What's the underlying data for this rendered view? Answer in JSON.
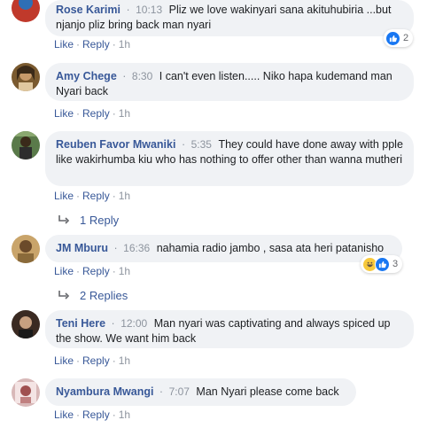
{
  "actions": {
    "like": "Like",
    "reply": "Reply",
    "dot": "·"
  },
  "comments": [
    {
      "author": "Rose Karimi",
      "time": "10:13",
      "text": "Pliz we love wakinyari sana akituhubiria ...but njanjo pliz bring back man nyari",
      "age": "1h",
      "reactions": {
        "icons": [
          "like-icon"
        ],
        "count": "2"
      },
      "avatar_colors": [
        "#c0392b",
        "#2e6fb5"
      ]
    },
    {
      "author": "Amy Chege",
      "time": "8:30",
      "text": "I can't even listen..... Niko hapa kudemand man Nyari back",
      "age": "1h",
      "avatar_colors": [
        "#7a5a2f",
        "#3b2a18"
      ]
    },
    {
      "author": "Reuben Favor Mwaniki",
      "time": "5:35",
      "text": "They could have done away with pple like wakirhumba kiu who has nothing to offer other than wanna mutheri",
      "age": "1h",
      "replies": "1 Reply",
      "avatar_colors": [
        "#5a7a4a",
        "#2d2d2d"
      ]
    },
    {
      "author": "JM Mburu",
      "time": "16:36",
      "text": "nahamia radio jambo , sasa ata heri patanisho",
      "age": "1h",
      "replies": "2 Replies",
      "reactions": {
        "icons": [
          "haha-icon",
          "like-icon"
        ],
        "count": "3"
      },
      "avatar_colors": [
        "#c9a46a",
        "#6b4a2a"
      ]
    },
    {
      "author": "Teni Here",
      "time": "12:00",
      "text": "Man nyari was captivating and always spiced up the show. We want him back",
      "age": "1h",
      "avatar_colors": [
        "#3a2a22",
        "#c8a080"
      ]
    },
    {
      "author": "Nyambura Mwangi",
      "time": "7:07",
      "text": "Man Nyari please come back",
      "age": "1h",
      "avatar_colors": [
        "#d8b8b8",
        "#a05050"
      ]
    }
  ]
}
